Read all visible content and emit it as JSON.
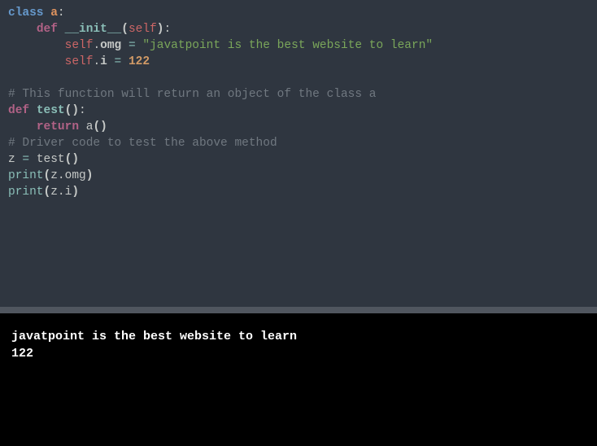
{
  "code": {
    "l1_kw_class": "class",
    "l1_cls_name": "a",
    "l1_colon": ":",
    "l2_indent": "    ",
    "l2_kw_def": "def",
    "l2_fn_name": "__init__",
    "l2_paren_open": "(",
    "l2_self": "self",
    "l2_paren_close": ")",
    "l2_colon": ":",
    "l3_indent": "        ",
    "l3_self": "self",
    "l3_dot": ".",
    "l3_attr": "omg",
    "l3_eq": " = ",
    "l3_str": "\"javatpoint is the best website to learn\"",
    "l4_indent": "        ",
    "l4_self": "self",
    "l4_dot": ".",
    "l4_attr": "i",
    "l4_eq": " = ",
    "l4_num": "122",
    "l6_cmt": "# This function will return an object of the class a",
    "l7_kw_def": "def",
    "l7_fn_name": "test",
    "l7_parens": "()",
    "l7_colon": ":",
    "l8_indent": "    ",
    "l8_kw_return": "return",
    "l8_call": " a",
    "l8_parens": "()",
    "l9_cmt": "# Driver code to test the above method",
    "l10_var": "z",
    "l10_eq": " = ",
    "l10_call": "test",
    "l10_parens": "()",
    "l11_print": "print",
    "l11_paren_open": "(",
    "l11_z": "z",
    "l11_dot": ".",
    "l11_attr": "omg",
    "l11_paren_close": ")",
    "l12_print": "print",
    "l12_paren_open": "(",
    "l12_z": "z",
    "l12_dot": ".",
    "l12_attr": "i",
    "l12_paren_close": ")"
  },
  "output": {
    "line1": "javatpoint is the best website to learn",
    "line2": "122"
  }
}
